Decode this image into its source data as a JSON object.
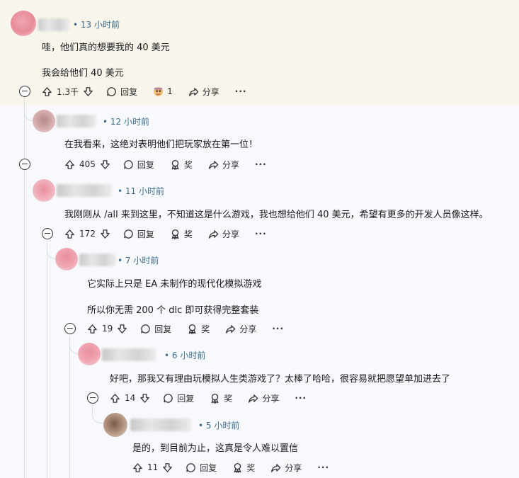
{
  "comments": [
    {
      "time": "13 小时前",
      "paragraphs": [
        "哇，他们真的想要我的 40 美元",
        "我会给他们 40 美元"
      ],
      "votes": "1.3千",
      "reply_label": "回复",
      "award_count": "1",
      "share_label": "分享",
      "more_label": "···"
    },
    {
      "time": "12 小时前",
      "paragraphs": [
        "在我看来，这绝对表明他们把玩家放在第一位！"
      ],
      "votes": "405",
      "reply_label": "回复",
      "award_label": "奖",
      "share_label": "分享",
      "more_label": "···"
    },
    {
      "time": "11 小时前",
      "paragraphs": [
        "我刚刚从 /all 来到这里，不知道这是什么游戏，我也想给他们 40 美元，希望有更多的开发人员像这样。"
      ],
      "votes": "172",
      "reply_label": "回复",
      "award_label": "奖",
      "share_label": "分享",
      "more_label": "···"
    },
    {
      "time": "7 小时前",
      "paragraphs": [
        "它实际上只是 EA 未制作的现代化模拟游戏",
        "所以你无需 200 个 dlc 即可获得完整套装"
      ],
      "votes": "19",
      "reply_label": "回复",
      "award_label": "奖",
      "share_label": "分享",
      "more_label": "···"
    },
    {
      "time": "6 小时前",
      "paragraphs": [
        "好吧，那我又有理由玩模拟人生类游戏了？太棒了哈哈，很容易就把愿望单加进去了"
      ],
      "votes": "14",
      "reply_label": "回复",
      "award_label": "奖",
      "share_label": "分享",
      "more_label": "···"
    },
    {
      "time": "5 小时前",
      "paragraphs": [
        "是的，到目前为止，这真是令人难以置信"
      ],
      "votes": "11",
      "reply_label": "回复",
      "award_label": "奖",
      "share_label": "分享",
      "more_label": "···"
    }
  ],
  "colors": {
    "highlight_bg": "#f7f5ec",
    "page_bg": "#f7f9fc",
    "meta_text": "#3f6e8c",
    "thread_line": "#d9dde3"
  }
}
